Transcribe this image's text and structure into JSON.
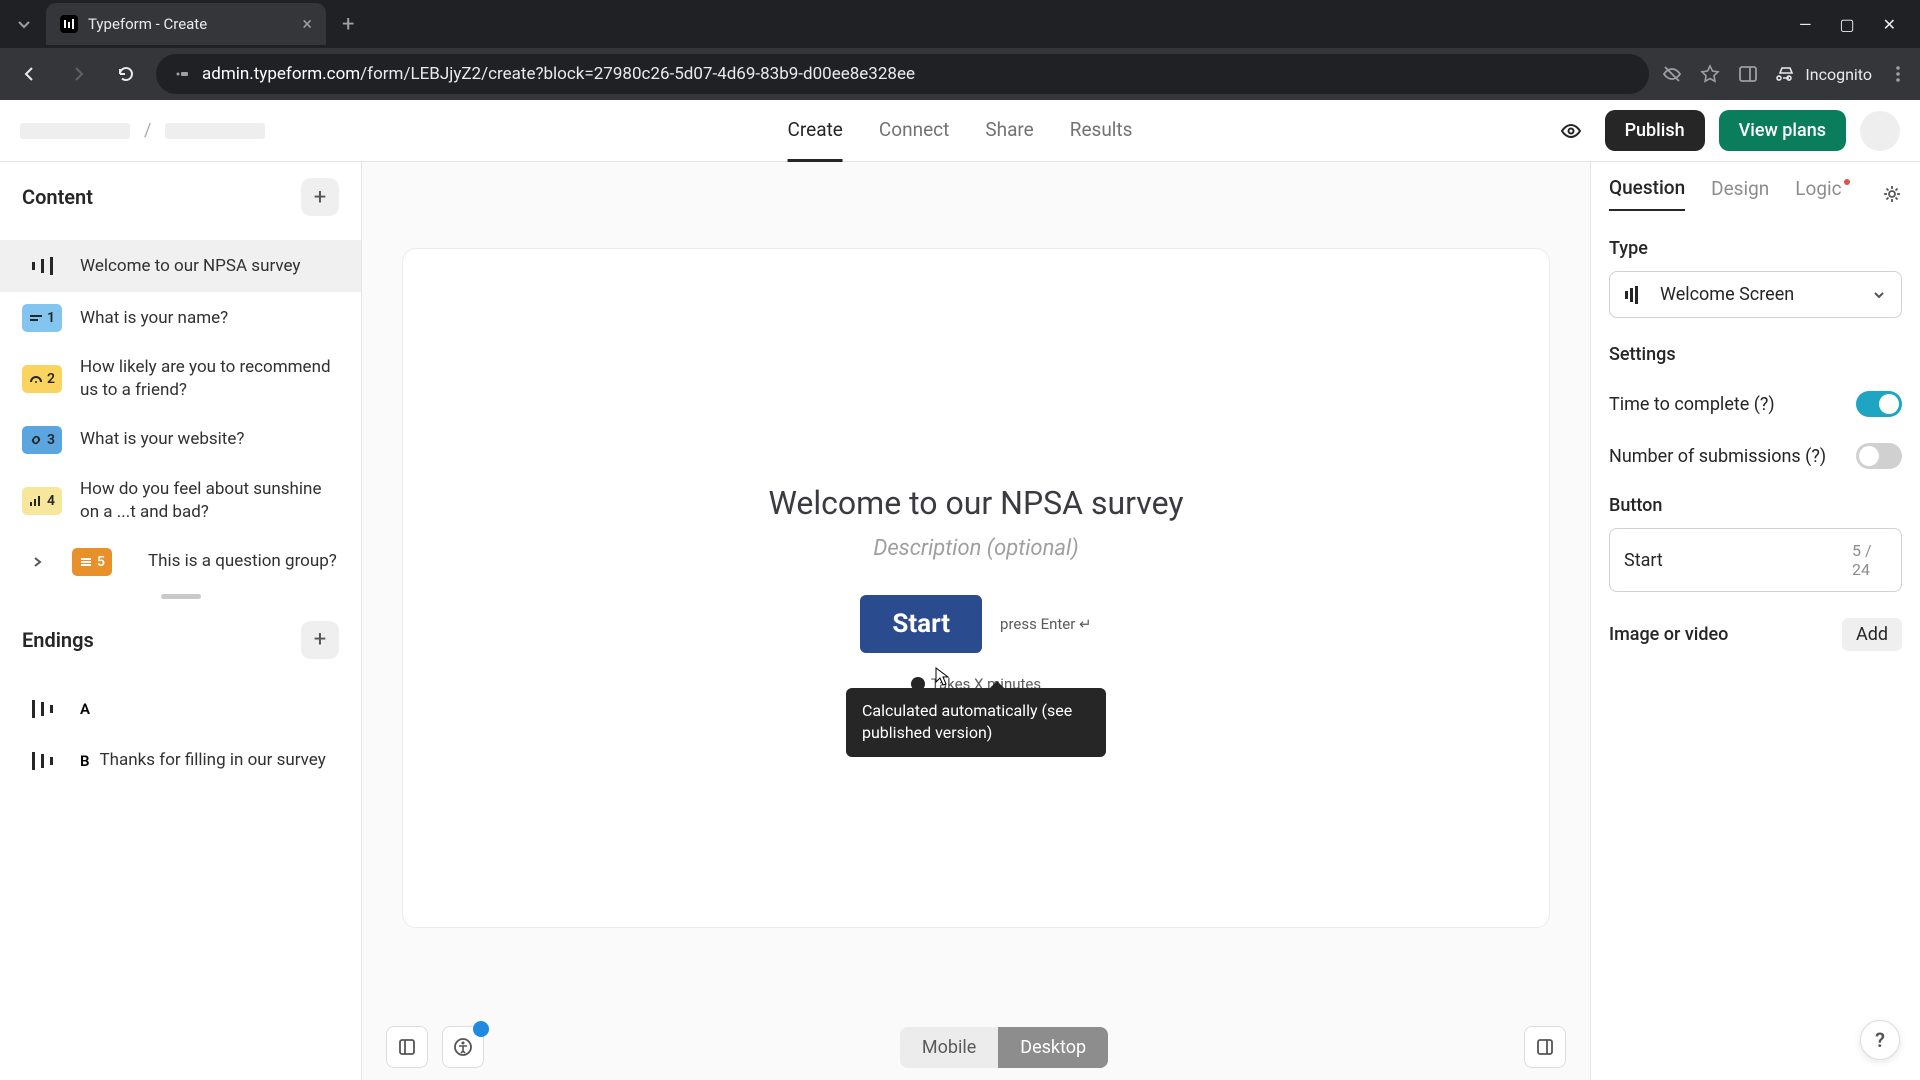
{
  "browser": {
    "tab_title": "Typeform - Create",
    "url_domain": "admin.typeform.com",
    "url_path": "/form/LEBJjyZ2/create?block=27980c26-5d07-4d69-83b9-d00ee8e328ee",
    "incognito": "Incognito"
  },
  "header": {
    "tabs": {
      "create": "Create",
      "connect": "Connect",
      "share": "Share",
      "results": "Results"
    },
    "publish": "Publish",
    "view_plans": "View plans"
  },
  "sidebar": {
    "content_title": "Content",
    "endings_title": "Endings",
    "items": [
      {
        "label": "Welcome to our NPSA survey"
      },
      {
        "num": "1",
        "label": "What is your name?"
      },
      {
        "num": "2",
        "label": "How likely are you to recommend us to a friend?"
      },
      {
        "num": "3",
        "label": "What is your website?"
      },
      {
        "num": "4",
        "label": "How do you feel about sunshine on a ...t and bad?"
      },
      {
        "num": "5",
        "label": "This is a question group?"
      }
    ],
    "endings": [
      {
        "letter": "A",
        "label": ""
      },
      {
        "letter": "B",
        "label": "Thanks for filling in our survey"
      }
    ]
  },
  "canvas": {
    "title": "Welcome to our NPSA survey",
    "description_placeholder": "Description (optional)",
    "start_label": "Start",
    "press_enter": "press Enter ↵",
    "takes": "Takes X minutes",
    "tooltip": "Calculated automatically (see published version)",
    "mobile": "Mobile",
    "desktop": "Desktop"
  },
  "right": {
    "tabs": {
      "question": "Question",
      "design": "Design",
      "logic": "Logic"
    },
    "type_label": "Type",
    "type_value": "Welcome Screen",
    "settings_label": "Settings",
    "time_to_complete": "Time to complete (?)",
    "num_submissions": "Number of submissions (?)",
    "button_label": "Button",
    "button_value": "Start",
    "char_count": "5 / 24",
    "image_video": "Image or video",
    "add": "Add"
  },
  "help": "?"
}
